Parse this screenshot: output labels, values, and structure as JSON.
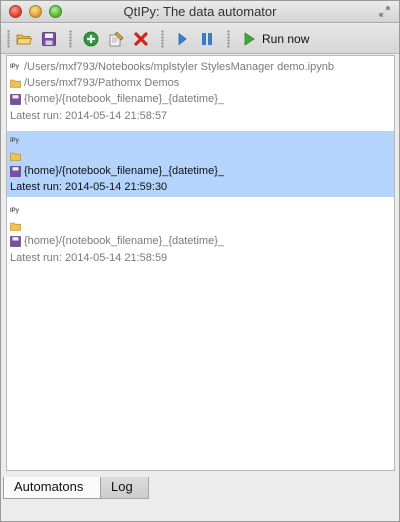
{
  "window": {
    "title": "QtIPy: The data automator"
  },
  "toolbar": {
    "run_now_label": "Run now",
    "icons": [
      "folder-open-icon",
      "save-icon",
      "add-icon",
      "edit-icon",
      "delete-icon",
      "play-icon",
      "pause-icon",
      "run-now-icon"
    ]
  },
  "automatons": [
    {
      "badge": "IPy",
      "notebook": "/Users/mxf793/Notebooks/mplstyler StylesManager demo.ipynb",
      "watch_folder": "/Users/mxf793/Pathomx Demos",
      "output_pattern": "{home}/{notebook_filename}_{datetime}_",
      "latest_run": "Latest run: 2014-05-14 21:58:57",
      "selected": false
    },
    {
      "badge": "IPy",
      "notebook": "",
      "watch_folder": "",
      "output_pattern": "{home}/{notebook_filename}_{datetime}_",
      "latest_run": "Latest run: 2014-05-14 21:59:30",
      "selected": true
    },
    {
      "badge": "IPy",
      "notebook": "",
      "watch_folder": "",
      "output_pattern": "{home}/{notebook_filename}_{datetime}_",
      "latest_run": "Latest run: 2014-05-14 21:58:59",
      "selected": false
    }
  ],
  "tabs": [
    {
      "label": "Automatons",
      "active": true
    },
    {
      "label": "Log",
      "active": false
    }
  ],
  "colors": {
    "selection": "#b5d4fd",
    "dim_text": "#7a7a7a"
  }
}
